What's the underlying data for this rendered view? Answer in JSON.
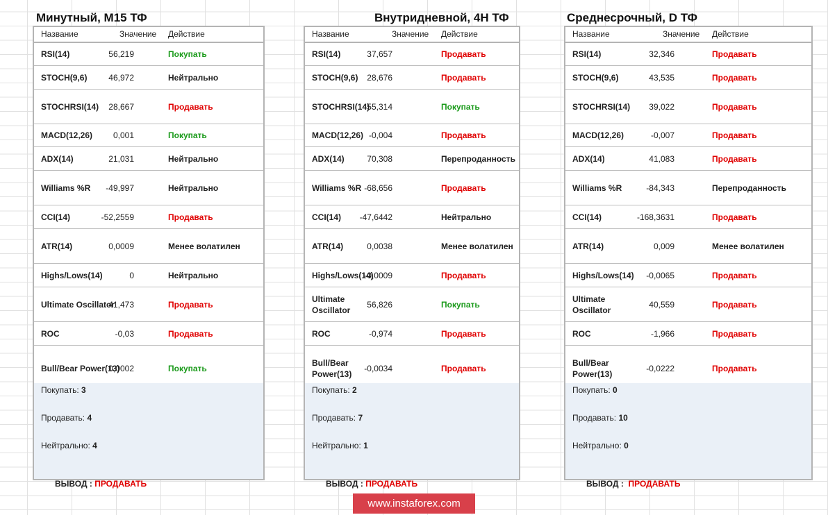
{
  "panels": [
    {
      "title": "Минутный, M15 ТФ",
      "headers": {
        "name": "Название",
        "value": "Значение",
        "action": "Действие"
      },
      "rows": [
        {
          "name": "RSI(14)",
          "value": "56,219",
          "action": "Покупать",
          "tone": "buy"
        },
        {
          "name": "STOCH(9,6)",
          "value": "46,972",
          "action": "Нейтрально",
          "tone": "neutral"
        },
        {
          "name": "STOCHRSI(14)",
          "value": "28,667",
          "action": "Продавать",
          "tone": "sell"
        },
        {
          "name": "MACD(12,26)",
          "value": "0,001",
          "action": "Покупать",
          "tone": "buy"
        },
        {
          "name": "ADX(14)",
          "value": "21,031",
          "action": "Нейтрально",
          "tone": "neutral"
        },
        {
          "name": "Williams %R",
          "value": "-49,997",
          "action": "Нейтрально",
          "tone": "neutral"
        },
        {
          "name": "CCI(14)",
          "value": "-52,2559",
          "action": "Продавать",
          "tone": "sell"
        },
        {
          "name": "ATR(14)",
          "value": "0,0009",
          "action": "Менее волатилен",
          "tone": "neutral"
        },
        {
          "name": "Highs/Lows(14)",
          "value": "0",
          "action": "Нейтрально",
          "tone": "neutral"
        },
        {
          "name": "Ultimate Oscillator",
          "value": "41,473",
          "action": "Продавать",
          "tone": "sell"
        },
        {
          "name": "ROC",
          "value": "-0,03",
          "action": "Продавать",
          "tone": "sell"
        },
        {
          "name": "Bull/Bear Power(13)",
          "value": "0,0002",
          "action": "Покупать",
          "tone": "buy"
        }
      ],
      "summary": {
        "buy_label": "Покупать: ",
        "buy_count": "3",
        "sell_label": "Продавать: ",
        "sell_count": "4",
        "neutral_label": "Нейтрально: ",
        "neutral_count": "4",
        "conclusion_label": "ВЫВОД : ",
        "conclusion_value": "ПРОДАВАТЬ"
      }
    },
    {
      "title": "Внутридневной, 4H ТФ",
      "headers": {
        "name": "Название",
        "value": "Значение",
        "action": "Действие"
      },
      "rows": [
        {
          "name": "RSI(14)",
          "value": "37,657",
          "action": "Продавать",
          "tone": "sell"
        },
        {
          "name": "STOCH(9,6)",
          "value": "28,676",
          "action": "Продавать",
          "tone": "sell"
        },
        {
          "name": "STOCHRSI(14)",
          "value": "55,314",
          "action": "Покупать",
          "tone": "buy"
        },
        {
          "name": "MACD(12,26)",
          "value": "-0,004",
          "action": "Продавать",
          "tone": "sell"
        },
        {
          "name": "ADX(14)",
          "value": "70,308",
          "action": "Перепроданность",
          "tone": "neutral"
        },
        {
          "name": "Williams %R",
          "value": "-68,656",
          "action": "Продавать",
          "tone": "sell"
        },
        {
          "name": "CCI(14)",
          "value": "-47,6442",
          "action": "Нейтрально",
          "tone": "neutral"
        },
        {
          "name": "ATR(14)",
          "value": "0,0038",
          "action": "Менее волатилен",
          "tone": "neutral"
        },
        {
          "name": "Highs/Lows(14)",
          "value": "-0,0009",
          "action": "Продавать",
          "tone": "sell"
        },
        {
          "name": "Ultimate Oscillator",
          "value": "56,826",
          "action": "Покупать",
          "tone": "buy"
        },
        {
          "name": "ROC",
          "value": "-0,974",
          "action": "Продавать",
          "tone": "sell"
        },
        {
          "name": "Bull/Bear Power(13)",
          "value": "-0,0034",
          "action": "Продавать",
          "tone": "sell"
        }
      ],
      "summary": {
        "buy_label": "Покупать: ",
        "buy_count": "2",
        "sell_label": "Продавать: ",
        "sell_count": "7",
        "neutral_label": "Нейтрально: ",
        "neutral_count": "1",
        "conclusion_label": "ВЫВОД : ",
        "conclusion_value": "ПРОДАВАТЬ"
      }
    },
    {
      "title": "Среднесрочный, D ТФ",
      "headers": {
        "name": "Название",
        "value": "Значение",
        "action": "Действие"
      },
      "rows": [
        {
          "name": "RSI(14)",
          "value": "32,346",
          "action": "Продавать",
          "tone": "sell"
        },
        {
          "name": "STOCH(9,6)",
          "value": "43,535",
          "action": "Продавать",
          "tone": "sell"
        },
        {
          "name": "STOCHRSI(14)",
          "value": "39,022",
          "action": "Продавать",
          "tone": "sell"
        },
        {
          "name": "MACD(12,26)",
          "value": "-0,007",
          "action": "Продавать",
          "tone": "sell"
        },
        {
          "name": "ADX(14)",
          "value": "41,083",
          "action": "Продавать",
          "tone": "sell"
        },
        {
          "name": "Williams %R",
          "value": "-84,343",
          "action": "Перепроданность",
          "tone": "neutral"
        },
        {
          "name": "CCI(14)",
          "value": "-168,3631",
          "action": "Продавать",
          "tone": "sell"
        },
        {
          "name": "ATR(14)",
          "value": "0,009",
          "action": "Менее волатилен",
          "tone": "neutral"
        },
        {
          "name": "Highs/Lows(14)",
          "value": "-0,0065",
          "action": "Продавать",
          "tone": "sell"
        },
        {
          "name": "Ultimate Oscillator",
          "value": "40,559",
          "action": "Продавать",
          "tone": "sell"
        },
        {
          "name": "ROC",
          "value": "-1,966",
          "action": "Продавать",
          "tone": "sell"
        },
        {
          "name": "Bull/Bear Power(13)",
          "value": "-0,0222",
          "action": "Продавать",
          "tone": "sell"
        }
      ],
      "summary": {
        "buy_label": "Покупать: ",
        "buy_count": "0",
        "sell_label": "Продавать: ",
        "sell_count": "10",
        "neutral_label": "Нейтрально: ",
        "neutral_count": "0",
        "conclusion_label": "ВЫВОД :  ",
        "conclusion_value": "ПРОДАВАТЬ"
      }
    }
  ],
  "colors": {
    "buy": "#1a9a1a",
    "sell": "#e00000",
    "neutral": "#222222"
  },
  "watermark": "www.instaforex.com"
}
